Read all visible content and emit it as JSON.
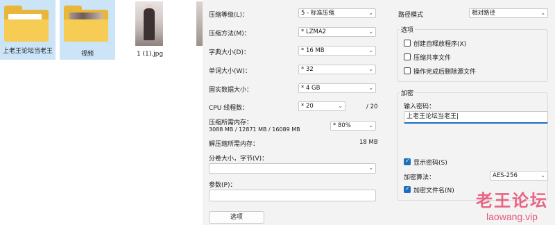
{
  "explorer": {
    "items": [
      {
        "label": "上老王论坛当老王",
        "selected": true
      },
      {
        "label": "视频",
        "selected": true
      },
      {
        "label": "1 (1).jpg",
        "selected": false
      }
    ]
  },
  "dialog": {
    "compression_level": {
      "label": "压缩等级(L)：",
      "value": "5 - 标准压缩"
    },
    "compression_method": {
      "label": "压缩方法(M)：",
      "value": "* LZMA2"
    },
    "dictionary_size": {
      "label": "字典大小(D)：",
      "value": "* 16 MB"
    },
    "word_size": {
      "label": "单词大小(W)：",
      "value": "* 32"
    },
    "solid_block_size": {
      "label": "固实数据大小：",
      "value": "* 4 GB"
    },
    "cpu_threads": {
      "label": "CPU 线程数：",
      "value": "* 20",
      "max": "/ 20"
    },
    "memory_compress": {
      "label": "压缩所需内存：",
      "detail": "3088 MB / 12871 MB / 16089 MB",
      "value": "* 80%"
    },
    "memory_decompress": {
      "label": "解压缩所需内存：",
      "value": "18 MB"
    },
    "split_volume": {
      "label": "分卷大小，字节(V)：",
      "value": ""
    },
    "parameters": {
      "label": "参数(P)：",
      "value": ""
    },
    "options_button": "选项",
    "path_mode": {
      "label": "路径模式",
      "value": "相对路径"
    },
    "options_group": {
      "title": "选项",
      "items": [
        {
          "label": "创建自释放程序(X)",
          "checked": false
        },
        {
          "label": "压缩共享文件",
          "checked": false
        },
        {
          "label": "操作完成后删除源文件",
          "checked": false
        }
      ]
    },
    "encryption_group": {
      "title": "加密",
      "password_label": "输入密码：",
      "password_value": "上老王论坛当老王|",
      "show_password": {
        "label": "显示密码(S)",
        "checked": true
      },
      "method_label": "加密算法：",
      "method_value": "AES-256",
      "encrypt_names": {
        "label": "加密文件名(N)",
        "checked": true
      }
    }
  },
  "watermark": {
    "title": "老王论坛",
    "url": "laowang.vip"
  },
  "colors": {
    "accent": "#1a6fbd",
    "folder": "#f7cc55",
    "selection": "#cce4f7",
    "watermark": "#e8567a"
  }
}
